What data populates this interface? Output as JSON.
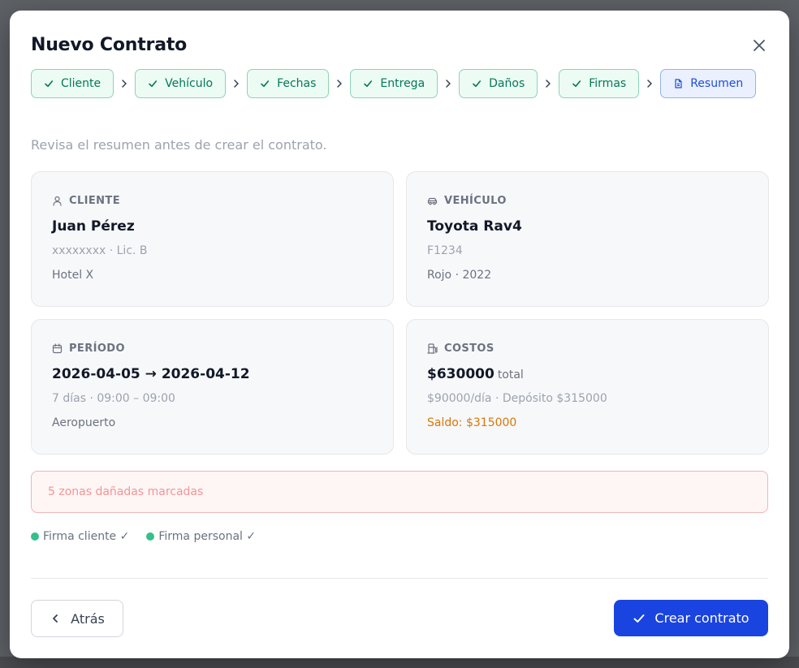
{
  "modal": {
    "title": "Nuevo Contrato",
    "close_icon": "close-icon"
  },
  "stepper": {
    "steps": [
      {
        "label": "Cliente",
        "status": "done",
        "icon": "check-icon"
      },
      {
        "label": "Vehículo",
        "status": "done",
        "icon": "check-icon"
      },
      {
        "label": "Fechas",
        "status": "done",
        "icon": "check-icon"
      },
      {
        "label": "Entrega",
        "status": "done",
        "icon": "check-icon"
      },
      {
        "label": "Daños",
        "status": "done",
        "icon": "check-icon"
      },
      {
        "label": "Firmas",
        "status": "done",
        "icon": "check-icon"
      },
      {
        "label": "Resumen",
        "status": "active",
        "icon": "document-icon"
      }
    ],
    "separator_icon": "chevron-right-icon"
  },
  "summary": {
    "subtitle": "Revisa el resumen antes de crear el contrato.",
    "client": {
      "label": "CLIENTE",
      "icon": "user-icon",
      "name": "Juan Pérez",
      "details": "xxxxxxxx · Lic. B",
      "hotel": "Hotel X"
    },
    "vehicle": {
      "label": "VEHÍCULO",
      "icon": "car-icon",
      "model": "Toyota Rav4",
      "plate": "F1234",
      "color_year": "Rojo · 2022"
    },
    "period": {
      "label": "PERÍODO",
      "icon": "calendar-icon",
      "range": "2026-04-05 → 2026-04-12",
      "duration": "7 días · 09:00 – 09:00",
      "location": "Aeropuerto"
    },
    "costs": {
      "label": "COSTOS",
      "icon": "fuel-icon",
      "total": "$630000",
      "total_suffix": "total",
      "breakdown": "$90000/día · Depósito $315000",
      "balance": "Saldo: $315000"
    },
    "damages": "5 zonas dañadas marcadas",
    "signatures": [
      {
        "label": "Firma cliente ✓"
      },
      {
        "label": "Firma personal ✓"
      }
    ]
  },
  "footer": {
    "back_label": "Atrás",
    "create_label": "Crear contrato"
  },
  "colors": {
    "primary": "#1a44e0",
    "success": "#047857",
    "warning": "#d97706",
    "danger_text": "#f19696",
    "signature_dot": "#34c08c"
  }
}
